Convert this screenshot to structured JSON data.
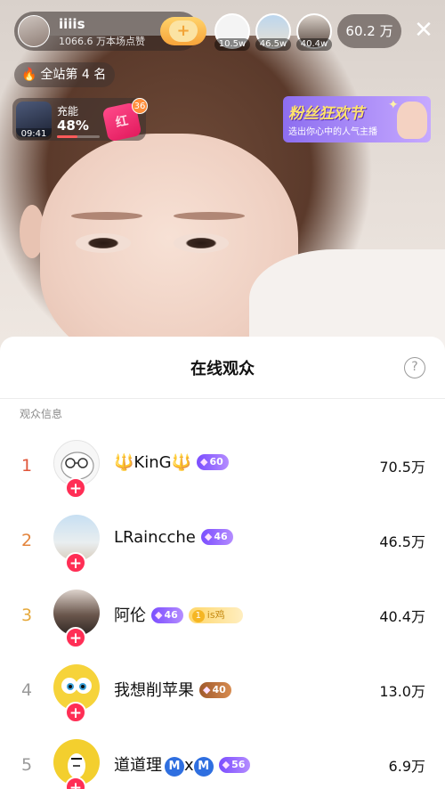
{
  "host": {
    "name": "iiiis",
    "likes": "1066.6 万本场点赞",
    "follow_symbol": "+"
  },
  "top_viewers": [
    {
      "tag": "10.5w"
    },
    {
      "tag": "46.5w"
    },
    {
      "tag": "40.4w"
    }
  ],
  "viewer_count": "60.2 万",
  "close_symbol": "✕",
  "site_rank": "全站第 4 名",
  "charge": {
    "time": "09:41",
    "label": "充能",
    "percent": "48%",
    "progress": 0.48
  },
  "redpack": {
    "count": "36"
  },
  "banner": {
    "title": "粉丝狂欢节",
    "subtitle": "选出你心中的人气主播"
  },
  "sheet": {
    "title": "在线观众",
    "help_symbol": "?",
    "section_label": "观众信息"
  },
  "viewers": [
    {
      "rank": "1",
      "name": "🔱KinG🔱",
      "level": "60",
      "fan_badge": null,
      "score": "70.5万"
    },
    {
      "rank": "2",
      "name": "LRaincche",
      "level": "46",
      "fan_badge": null,
      "score": "46.5万"
    },
    {
      "rank": "3",
      "name": "阿伦",
      "level": "46",
      "fan_badge": {
        "level": "1",
        "text": "is鸡"
      },
      "score": "40.4万"
    },
    {
      "rank": "4",
      "name": "我想削苹果",
      "level": "40",
      "fan_badge": null,
      "score": "13.0万"
    },
    {
      "rank": "5",
      "name": "道道理",
      "name_suffix": "x",
      "badge_letter": "M",
      "level": "56",
      "fan_badge": null,
      "score": "6.9万"
    }
  ],
  "colors": {
    "rank1": "#e0563a",
    "rank2": "#e3843c",
    "rank3": "#e6a93c",
    "rank_other": "#9a9a9a",
    "plus_badge": "#ff2e55",
    "level_badge": "#8a5cff"
  },
  "icons": {
    "help": "question-circle-icon",
    "close": "close-icon",
    "flame": "flame-icon",
    "plus": "plus-icon",
    "gem": "gem-icon"
  }
}
